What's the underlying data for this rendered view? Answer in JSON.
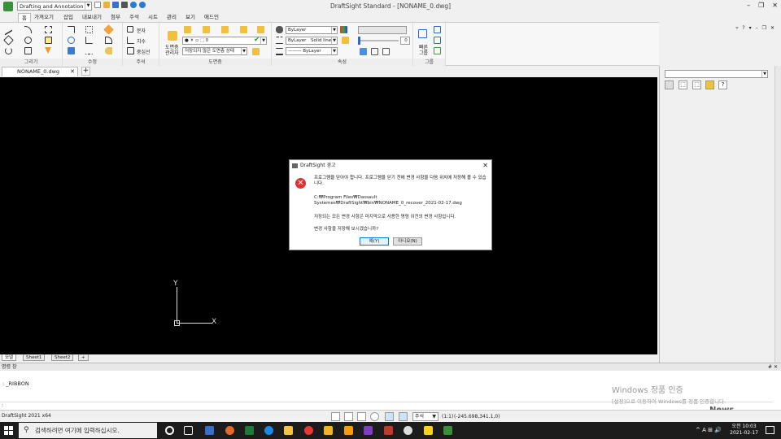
{
  "window": {
    "title": "DraftSight Standard - [NONAME_0.dwg]",
    "workspace": "Drafting and Annotation",
    "minimize": "–",
    "restore": "❐",
    "close": "✕"
  },
  "ribbon_tabs": [
    "홈",
    "가져오기",
    "삽입",
    "내보내기",
    "첨부",
    "주석",
    "시트",
    "관리",
    "보기",
    "애드인"
  ],
  "ribbon_right": [
    "▿",
    "?",
    "▾",
    "–",
    "❐",
    "✕"
  ],
  "ribbon": {
    "panels": {
      "draw": "그리기",
      "modify": "수정",
      "annotate": "주석",
      "layers": "도면층",
      "properties": "속성",
      "group": "그룹"
    },
    "annotate": {
      "text": "문자",
      "dimension": "치수",
      "centerline": "중심선"
    },
    "layers": {
      "manager_line1": "도면층",
      "manager_line2": "관리자",
      "layer_combo": "● ☀ ▫ ⬚ 0",
      "state_combo": "저장되지 않은 도면층 상태"
    },
    "properties": {
      "color_combo": "ByLayer",
      "linetype_combo": "ByLayer",
      "linetype_style": "Solid line",
      "lineweight_combo": "——— ByLayer",
      "transparency_value": "0"
    },
    "group": {
      "quick_line1": "빠른",
      "quick_line2": "그룹"
    }
  },
  "doc_tab": {
    "name": "NONAME_0.dwg",
    "close": "✕",
    "add": "+"
  },
  "layout_tabs": [
    "모델",
    "Sheet1",
    "Sheet2",
    "+"
  ],
  "ucs": {
    "x_label": "X",
    "y_label": "Y"
  },
  "right_panel": {
    "help": "?"
  },
  "command": {
    "header": "명령 창",
    "header_buttons": "# ✕",
    "history": ": _RIBBON",
    "prompt": ":"
  },
  "watermark": {
    "title": "Windows 정품 인증",
    "subtitle": "[설정]으로 이동하여 Windows를 정품 인증합니다."
  },
  "news": "News",
  "status": {
    "app": "DraftSight 2021 x64",
    "annotation_scale": "주석",
    "scale_ratio": "(1:1)",
    "coords": "(-245.698,341.1,0)"
  },
  "taskbar": {
    "search_placeholder": "검색하려면 여기에 입력하십시오.",
    "time": "오전 10:03",
    "date": "2021-02-17",
    "tray": "^  A  ⊞  🔊"
  },
  "dialog": {
    "title": "DraftSight 경고",
    "message": "프로그램을 닫아야 합니다. 프로그램을 닫기 전에 변경 사항을 다음 위치에 저장해 볼 수 있습니다.",
    "path_line1": "C:₩Program Files₩Dassault",
    "path_line2": "Systemes₩DraftSight₩bin₩NONAME_0_recover_2021-02-17.dwg",
    "note": "저장되는 모든 변경 사항은 마지막으로 사용한 명령 이전의 변경 사항입니다.",
    "question": "변경 사항을 저장해 보시겠습니까?",
    "yes": "예(Y)",
    "no": "아니요(N)"
  },
  "colors": {
    "canvas": "#000000",
    "error": "#e03030",
    "taskbar": "#1c1c1c",
    "accent": "#0078d7"
  }
}
